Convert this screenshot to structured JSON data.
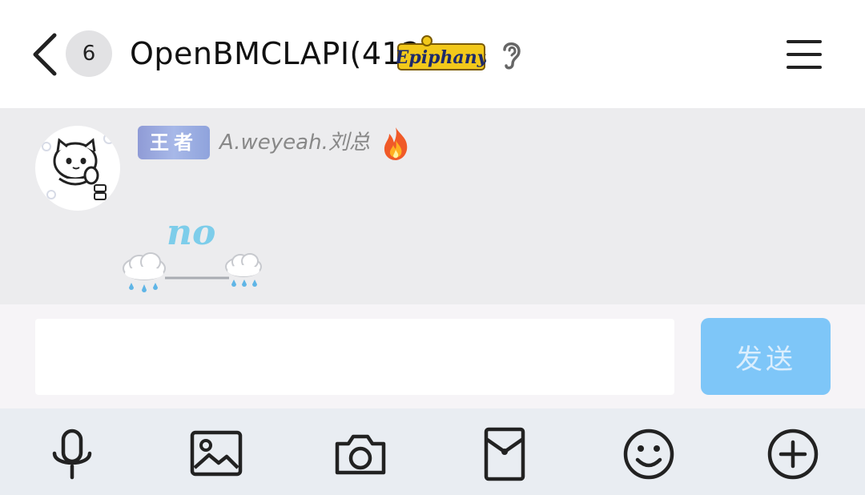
{
  "header": {
    "back_icon": "chevron-left-icon",
    "unread_count": "6",
    "title": "OpenBMCLAPI(412)",
    "title_badge_text": "Epiphany",
    "ear_icon": "ear-icon",
    "menu_icon": "hamburger-menu-icon"
  },
  "message": {
    "role_badge": "王者",
    "sender_name": "A.weyeah.刘总",
    "fire_icon": "fire-icon",
    "text": "no",
    "decoration_icon": "rain-cloud-icon"
  },
  "composer": {
    "input_value": "",
    "input_placeholder": "",
    "send_label": "发送"
  },
  "toolbar": {
    "items": [
      {
        "icon": "microphone-icon"
      },
      {
        "icon": "image-icon"
      },
      {
        "icon": "camera-icon"
      },
      {
        "icon": "red-packet-icon"
      },
      {
        "icon": "emoji-icon"
      },
      {
        "icon": "plus-circle-icon"
      }
    ]
  },
  "colors": {
    "send_button": "#7ec6f8",
    "chat_background": "#ececee",
    "toolbar_background": "#e9edf2",
    "message_text": "#7dcdea",
    "role_badge": "#a7b8e8"
  }
}
